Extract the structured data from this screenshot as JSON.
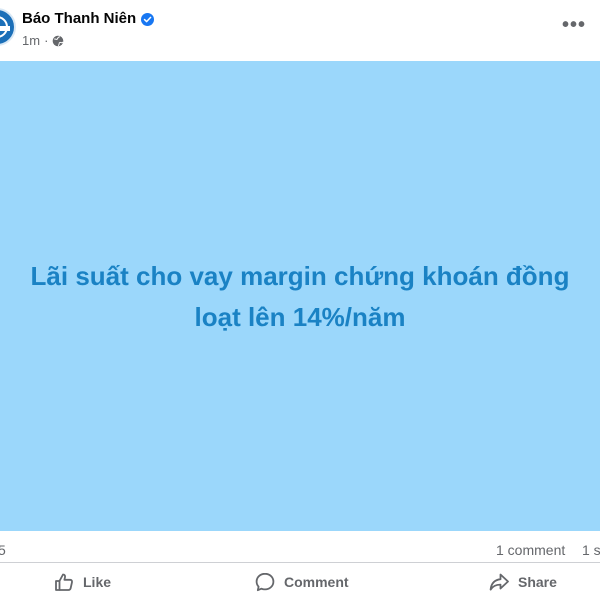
{
  "post": {
    "page_name": "Báo Thanh Niên",
    "verified_icon": "verified-badge-icon",
    "time": "1m",
    "separator": "·",
    "audience_icon": "globe-icon",
    "more_icon": "more-options-icon",
    "more_label": "•••"
  },
  "image": {
    "background": "#9bd7fb",
    "text_color": "#1a82c4",
    "headline_line1": "Lãi suất cho vay margin chứng khoán đồng",
    "headline_line2": "loạt lên 14%/năm"
  },
  "stats": {
    "reactions": "5",
    "comments": "1 comment",
    "shares": "1 s"
  },
  "actions": {
    "like_label": "Like",
    "comment_label": "Comment",
    "share_label": "Share"
  }
}
